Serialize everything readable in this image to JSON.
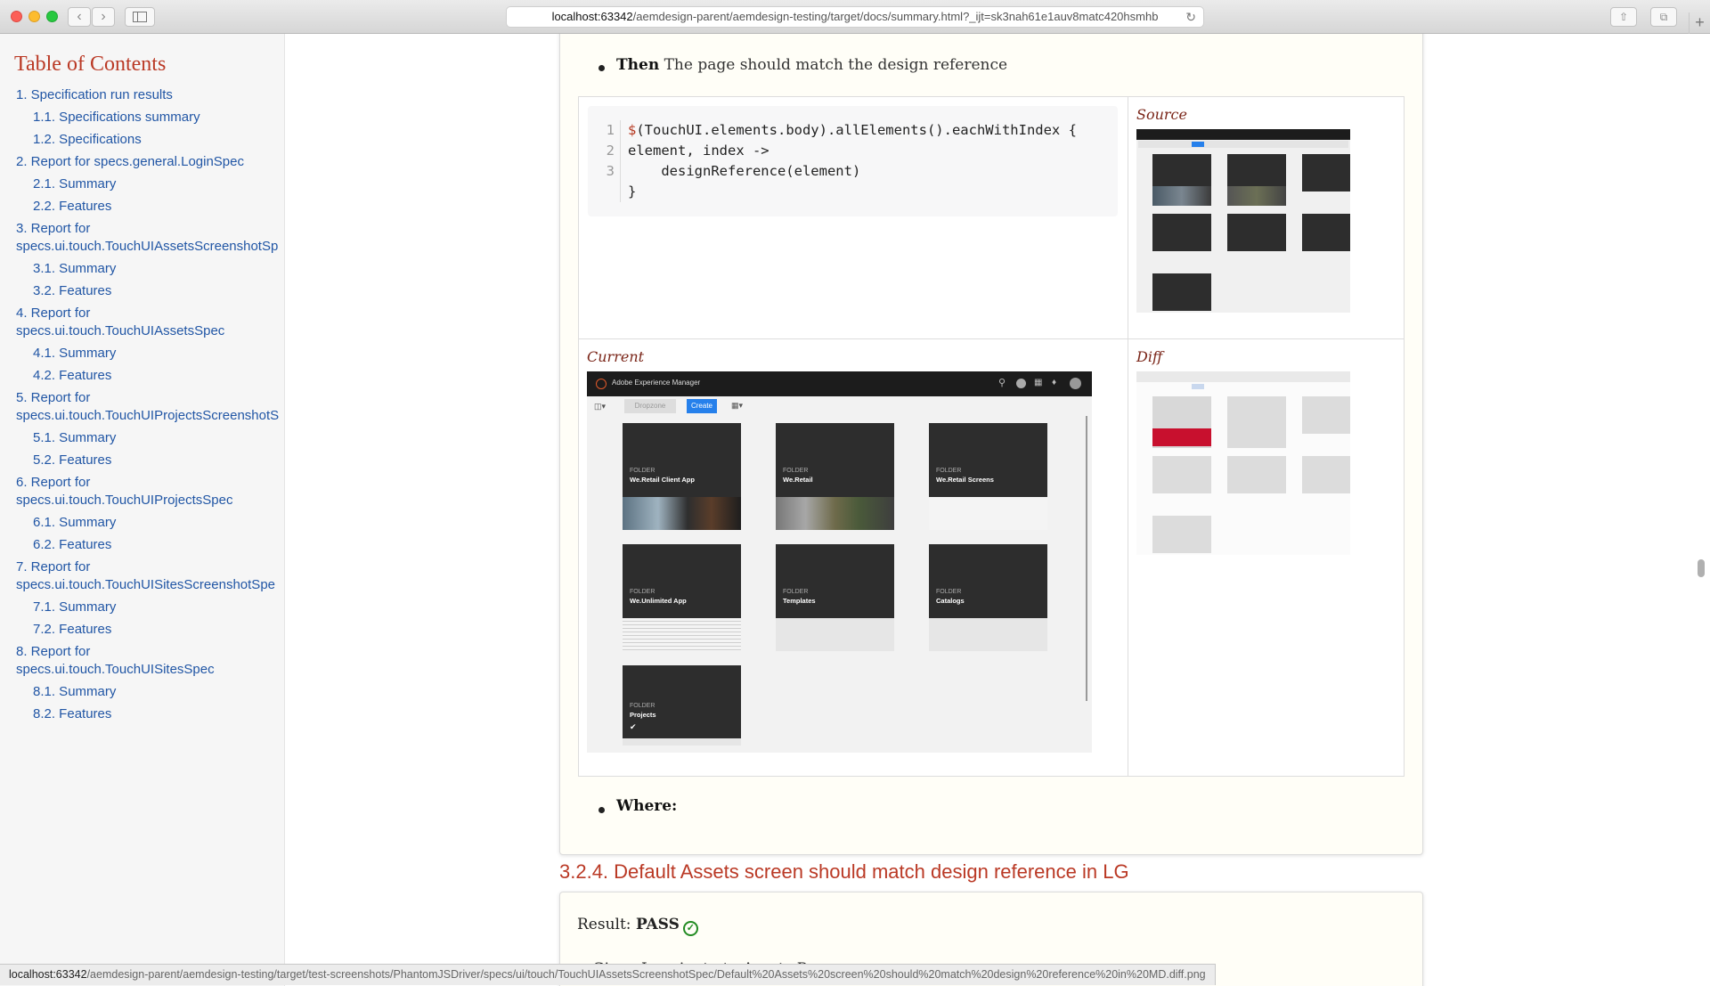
{
  "browser": {
    "url_host": "localhost:63342",
    "url_path": "/aemdesign-parent/aemdesign-testing/target/docs/summary.html?_ijt=sk3nah61e1auv8matc420hsmhb",
    "status_host": "localhost:63342",
    "status_path": "/aemdesign-parent/aemdesign-testing/target/test-screenshots/PhantomJSDriver/specs/ui/touch/TouchUIAssetsScreenshotSpec/Default%20Assets%20screen%20should%20match%20design%20reference%20in%20MD.diff.png"
  },
  "toc": {
    "title": "Table of Contents",
    "items": [
      {
        "label": "1. Specification run results",
        "level": 1
      },
      {
        "label": "1.1. Specifications summary",
        "level": 2
      },
      {
        "label": "1.2. Specifications",
        "level": 2
      },
      {
        "label": "2. Report for specs.general.LoginSpec",
        "level": 1
      },
      {
        "label": "2.1. Summary",
        "level": 2
      },
      {
        "label": "2.2. Features",
        "level": 2
      },
      {
        "label": "3. Report for",
        "level": 1
      },
      {
        "label": "specs.ui.touch.TouchUIAssetsScreenshotSp",
        "level": 0
      },
      {
        "label": "3.1. Summary",
        "level": 2
      },
      {
        "label": "3.2. Features",
        "level": 2
      },
      {
        "label": "4. Report for",
        "level": 1
      },
      {
        "label": "specs.ui.touch.TouchUIAssetsSpec",
        "level": 0
      },
      {
        "label": "4.1. Summary",
        "level": 2
      },
      {
        "label": "4.2. Features",
        "level": 2
      },
      {
        "label": "5. Report for",
        "level": 1
      },
      {
        "label": "specs.ui.touch.TouchUIProjectsScreenshotS",
        "level": 0
      },
      {
        "label": "5.1. Summary",
        "level": 2
      },
      {
        "label": "5.2. Features",
        "level": 2
      },
      {
        "label": "6. Report for",
        "level": 1
      },
      {
        "label": "specs.ui.touch.TouchUIProjectsSpec",
        "level": 0
      },
      {
        "label": "6.1. Summary",
        "level": 2
      },
      {
        "label": "6.2. Features",
        "level": 2
      },
      {
        "label": "7. Report for",
        "level": 1
      },
      {
        "label": "specs.ui.touch.TouchUISitesScreenshotSpe",
        "level": 0
      },
      {
        "label": "7.1. Summary",
        "level": 2
      },
      {
        "label": "7.2. Features",
        "level": 2
      },
      {
        "label": "8. Report for",
        "level": 1
      },
      {
        "label": "specs.ui.touch.TouchUISitesSpec",
        "level": 0
      },
      {
        "label": "8.1. Summary",
        "level": 2
      },
      {
        "label": "8.2. Features",
        "level": 2
      }
    ]
  },
  "step": {
    "keyword": "Then",
    "text": " The page should match the design reference",
    "where_label": "Where:"
  },
  "code": {
    "line_numbers": [
      "1",
      "2",
      "3",
      ""
    ],
    "dollar": "$",
    "lines": [
      "(TouchUI.elements.body).allElements().eachWithIndex {",
      "element, index ->",
      "    designReference(element)",
      "}"
    ]
  },
  "captions": {
    "source": "Source",
    "current": "Current",
    "diff": "Diff"
  },
  "aem": {
    "app_title": "Adobe Experience Manager",
    "dropzone": "Dropzone",
    "create": "Create",
    "folder_label": "FOLDER",
    "folders": [
      "We.Retail Client App",
      "We.Retail",
      "We.Retail Screens",
      "We.Unlimited App",
      "Templates",
      "Catalogs",
      "Projects"
    ]
  },
  "next_section": {
    "heading": "3.2.4. Default Assets screen should match design reference in LG",
    "result_label": "Result: ",
    "result_value": "PASS",
    "given_partial": "Given I navigate to Assets P"
  }
}
